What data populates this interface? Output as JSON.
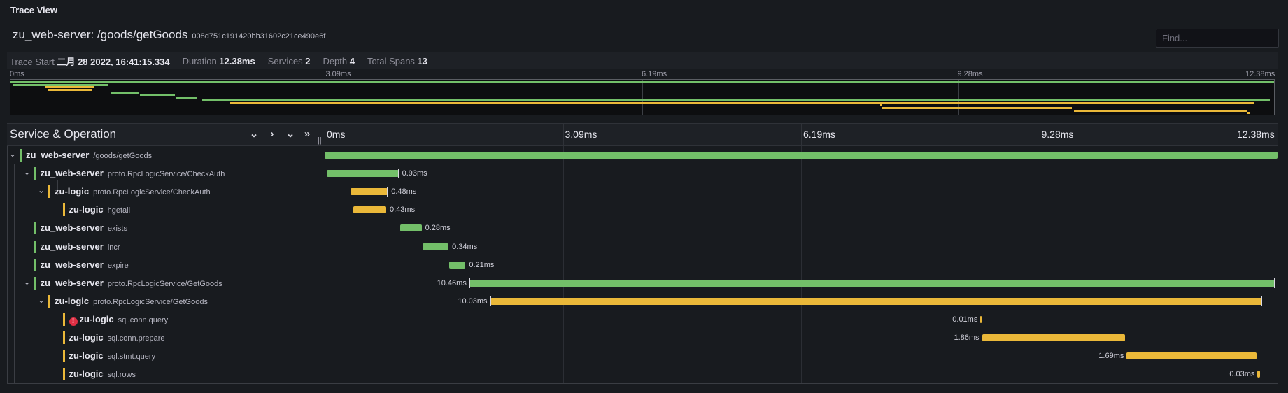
{
  "panel": {
    "title": "Trace View"
  },
  "trace": {
    "name": "zu_web-server: /goods/getGoods",
    "id": "008d751c191420bb31602c21ce490e6f",
    "find_placeholder": "Find...",
    "meta": {
      "start_label": "Trace Start",
      "start_value": "二月 28 2022, 16:41:15.334",
      "duration_label": "Duration",
      "duration_value": "12.38ms",
      "services_label": "Services",
      "services_value": "2",
      "depth_label": "Depth",
      "depth_value": "4",
      "spans_label": "Total Spans",
      "spans_value": "13"
    }
  },
  "ticks": [
    "0ms",
    "3.09ms",
    "6.19ms",
    "9.28ms",
    "12.38ms"
  ],
  "header": {
    "title": "Service & Operation",
    "handle": "||"
  },
  "colors": {
    "zu_web-server": "#73bf69",
    "zu-logic": "#eab839",
    "error": "#e02f44"
  },
  "spans": [
    {
      "service": "zu_web-server",
      "operation": "/goods/getGoods",
      "depth": 0,
      "expanded": true,
      "start": 0,
      "duration": 12.38
    },
    {
      "service": "zu_web-server",
      "operation": "proto.RpcLogicService/CheckAuth",
      "depth": 1,
      "expanded": true,
      "start": 0.03,
      "duration": 0.93,
      "label": "0.93ms",
      "label_pos": "right",
      "ticks": true
    },
    {
      "service": "zu-logic",
      "operation": "proto.RpcLogicService/CheckAuth",
      "depth": 2,
      "expanded": true,
      "start": 0.34,
      "duration": 0.48,
      "label": "0.48ms",
      "label_pos": "right",
      "ticks": true
    },
    {
      "service": "zu-logic",
      "operation": "hgetall",
      "depth": 3,
      "start": 0.37,
      "duration": 0.43,
      "label": "0.43ms",
      "label_pos": "right"
    },
    {
      "service": "zu_web-server",
      "operation": "exists",
      "depth": 1,
      "start": 0.98,
      "duration": 0.28,
      "label": "0.28ms",
      "label_pos": "right"
    },
    {
      "service": "zu_web-server",
      "operation": "incr",
      "depth": 1,
      "start": 1.27,
      "duration": 0.34,
      "label": "0.34ms",
      "label_pos": "right"
    },
    {
      "service": "zu_web-server",
      "operation": "expire",
      "depth": 1,
      "start": 1.62,
      "duration": 0.21,
      "label": "0.21ms",
      "label_pos": "right"
    },
    {
      "service": "zu_web-server",
      "operation": "proto.RpcLogicService/GetGoods",
      "depth": 1,
      "expanded": true,
      "start": 1.88,
      "duration": 10.46,
      "label": "10.46ms",
      "label_pos": "left",
      "ticks": true
    },
    {
      "service": "zu-logic",
      "operation": "proto.RpcLogicService/GetGoods",
      "depth": 2,
      "expanded": true,
      "start": 2.15,
      "duration": 10.03,
      "label": "10.03ms",
      "label_pos": "left",
      "ticks": true
    },
    {
      "service": "zu-logic",
      "operation": "sql.conn.query",
      "depth": 3,
      "error": true,
      "error_icon": "error-icon",
      "start": 8.52,
      "duration": 0.01,
      "label": "0.01ms",
      "label_pos": "left"
    },
    {
      "service": "zu-logic",
      "operation": "sql.conn.prepare",
      "depth": 3,
      "start": 8.54,
      "duration": 1.86,
      "label": "1.86ms",
      "label_pos": "left"
    },
    {
      "service": "zu-logic",
      "operation": "sql.stmt.query",
      "depth": 3,
      "start": 10.42,
      "duration": 1.69,
      "label": "1.69ms",
      "label_pos": "left"
    },
    {
      "service": "zu-logic",
      "operation": "sql.rows",
      "depth": 3,
      "start": 12.12,
      "duration": 0.03,
      "label": "0.03ms",
      "label_pos": "left"
    }
  ]
}
